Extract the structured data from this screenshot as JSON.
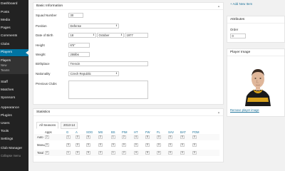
{
  "sidebar": {
    "items": [
      {
        "label": "Dashboard"
      },
      {
        "label": "Posts"
      },
      {
        "label": "Media"
      },
      {
        "label": "Pages"
      },
      {
        "label": "Comments"
      },
      {
        "label": "Clubs"
      },
      {
        "label": "Players"
      },
      {
        "label": "Staff"
      },
      {
        "label": "Matches"
      },
      {
        "label": "Sponsors"
      },
      {
        "label": "Appearance"
      },
      {
        "label": "Plugins"
      },
      {
        "label": "Users"
      },
      {
        "label": "Tools"
      },
      {
        "label": "Settings"
      },
      {
        "label": "Club Manager"
      }
    ],
    "submenu": [
      {
        "label": "Players"
      },
      {
        "label": "New"
      },
      {
        "label": "Teams"
      }
    ],
    "collapse_label": "Collapse menu"
  },
  "basic_info": {
    "title": "Basic Information",
    "toggle": "▲",
    "squad_number": {
      "label": "Squad Number",
      "value": "30"
    },
    "position": {
      "label": "Position",
      "value": "Defense"
    },
    "dob": {
      "label": "Date of Birth",
      "day": "18",
      "month": "October",
      "year": "1977"
    },
    "height": {
      "label": "Height",
      "value": "6'5\""
    },
    "weight": {
      "label": "Weight",
      "value": "255lbs"
    },
    "birthplace": {
      "label": "Birthplace",
      "value": "Trencin"
    },
    "nationality": {
      "label": "Nationality",
      "value": "Czech Republic"
    },
    "previous_clubs": {
      "label": "Previous Clubs",
      "value": ""
    }
  },
  "statistics": {
    "title": "Statistics",
    "toggle": "▲",
    "tabs": [
      "All Seasons",
      "2013-14"
    ],
    "columns": [
      "Apps",
      "G",
      "A",
      "SOG",
      "MS",
      "BS",
      "PIM",
      "HT",
      "FW",
      "FL",
      "SAV",
      "BAT",
      "POM"
    ],
    "rows": [
      {
        "label": "Auto",
        "values": [
          "2",
          "1",
          "0",
          "5",
          "2",
          "1",
          "2",
          "4",
          "5",
          "0",
          "0",
          "0",
          "0"
        ]
      },
      {
        "label": "Manual",
        "values": [
          "0",
          "0",
          "0",
          "0",
          "0",
          "0",
          "0",
          "0",
          "0",
          "0",
          "0",
          "0",
          "0"
        ]
      },
      {
        "label": "Total",
        "values": [
          "2",
          "1",
          "0",
          "5",
          "2",
          "1",
          "2",
          "4",
          "5",
          "0",
          "0",
          "0",
          "0"
        ]
      }
    ]
  },
  "add_new": "+ Add New Item",
  "attributes": {
    "title": "Attributes",
    "order_label": "Order",
    "order_value": "0"
  },
  "player_image": {
    "title": "Player Image",
    "remove_link": "Remove player image"
  }
}
